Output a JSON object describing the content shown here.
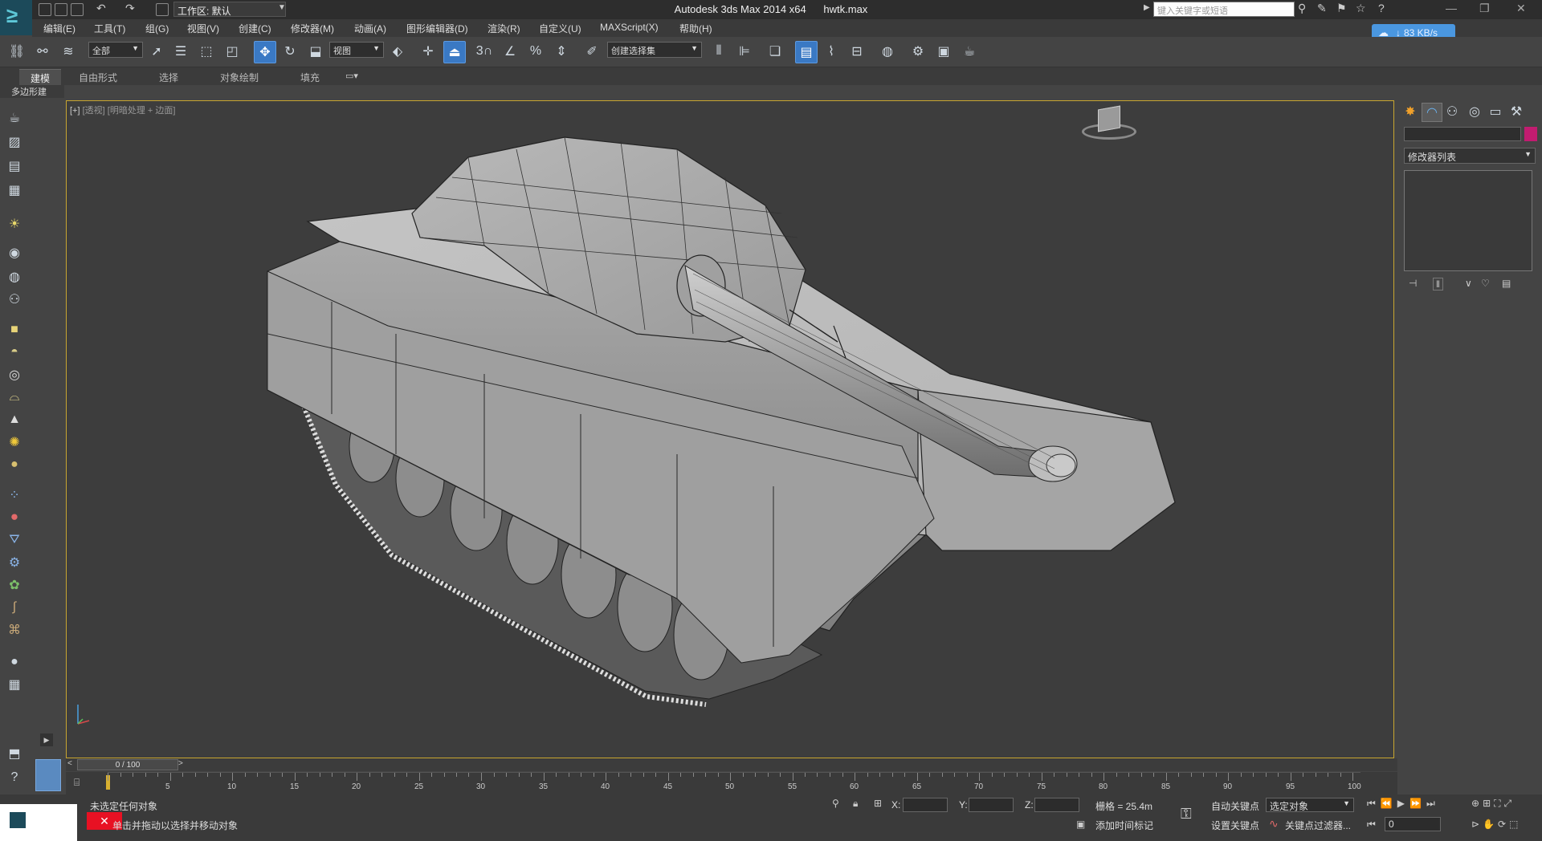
{
  "titlebar": {
    "app_title": "Autodesk 3ds Max  2014 x64",
    "file_name": "hwtk.max",
    "workspace_label": "工作区: 默认",
    "search_placeholder": "键入关键字或短语"
  },
  "menu": [
    "编辑(E)",
    "工具(T)",
    "组(G)",
    "视图(V)",
    "创建(C)",
    "修改器(M)",
    "动画(A)",
    "图形编辑器(D)",
    "渲染(R)",
    "自定义(U)",
    "MAXScript(X)",
    "帮助(H)"
  ],
  "toolbar": {
    "selection_filter": "全部",
    "ref_coord": "视图",
    "named_selection": "创建选择集",
    "snap_label": "3"
  },
  "ribbon": {
    "tabs": [
      "建模",
      "自由形式",
      "选择",
      "对象绘制",
      "填充"
    ],
    "active_tab": "建模",
    "sub_label": "多边形建模"
  },
  "viewport": {
    "label_plus": "[+]",
    "label_view": "[透视]",
    "label_shading": "[明暗处理 + 边面]"
  },
  "command_panel": {
    "modifier_list": "修改器列表"
  },
  "time": {
    "slider_label": "0 / 100",
    "ticks": [
      "5",
      "10",
      "15",
      "20",
      "25",
      "30",
      "35",
      "40",
      "45",
      "50",
      "55",
      "60",
      "65",
      "70",
      "75",
      "80",
      "85",
      "90",
      "95",
      "100"
    ]
  },
  "status": {
    "selection_status": "未选定任何对象",
    "prompt": "单击并拖动以选择并移动对象",
    "x_label": "X:",
    "y_label": "Y:",
    "z_label": "Z:",
    "grid": "栅格 = 25.4m",
    "add_time_tag": "添加时间标记",
    "auto_key": "自动关键点",
    "set_key": "设置关键点",
    "key_mode": "选定对象",
    "key_filters": "关键点过滤器...",
    "frame": "0"
  },
  "network": {
    "speed": "83 KB/s"
  }
}
